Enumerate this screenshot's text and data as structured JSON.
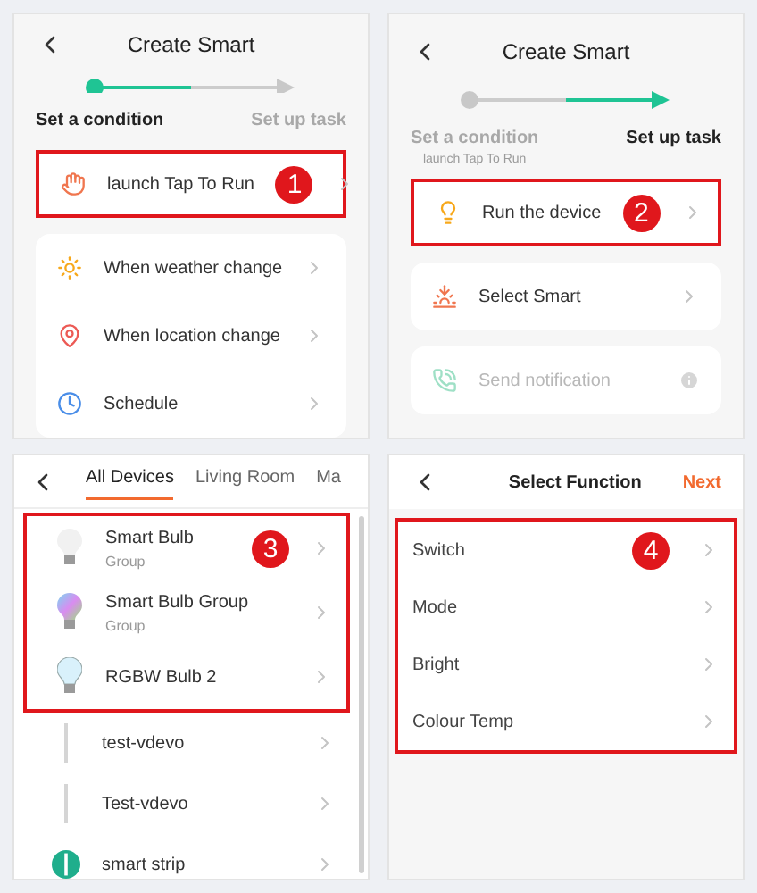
{
  "screens": [
    {
      "kind": "wizard",
      "title": "Create Smart",
      "steps": [
        {
          "label": "Set a condition",
          "selected": true
        },
        {
          "label": "Set up task",
          "selected": false
        }
      ],
      "highlighted": {
        "label": "launch Tap To Run",
        "kind": "tap",
        "callout": "1"
      },
      "cards": [
        {
          "items": [
            {
              "label": "When weather change",
              "kind": "weather",
              "disabled": false
            },
            {
              "label": "When location change",
              "kind": "location",
              "disabled": false
            },
            {
              "label": "Schedule",
              "kind": "schedule",
              "disabled": false
            }
          ]
        }
      ]
    },
    {
      "kind": "wizard",
      "title": "Create Smart",
      "steps": [
        {
          "label": "Set a condition",
          "sublabel": "launch Tap To Run",
          "selected": false
        },
        {
          "label": "Set up task",
          "selected": true
        }
      ],
      "highlighted": {
        "label": "Run the device",
        "kind": "device",
        "callout": "2"
      },
      "cards": [
        {
          "items": [
            {
              "label": "Select Smart",
              "kind": "scene",
              "disabled": false
            }
          ]
        },
        {
          "items": [
            {
              "label": "Send notification",
              "kind": "notify",
              "disabled": true
            }
          ]
        }
      ]
    },
    {
      "kind": "devices",
      "tabs": [
        {
          "label": "All Devices",
          "selected": true
        },
        {
          "label": "Living Room",
          "selected": false
        },
        {
          "label": "Ma",
          "selected": false
        }
      ],
      "callout": "3",
      "highlighted_devices": [
        {
          "name": "Smart Bulb",
          "subtitle": "Group",
          "kind": "bulb-white"
        },
        {
          "name": "Smart Bulb Group",
          "subtitle": "Group",
          "kind": "bulb-rgb"
        },
        {
          "name": "RGBW Bulb 2",
          "kind": "bulb-blue"
        }
      ],
      "devices": [
        {
          "name": "test-vdevo",
          "kind": "strip"
        },
        {
          "name": "Test-vdevo",
          "kind": "strip"
        },
        {
          "name": "smart strip",
          "kind": "strip-round"
        }
      ]
    },
    {
      "kind": "functions",
      "title": "Select Function",
      "action": "Next",
      "callout": "4",
      "functions": [
        "Switch",
        "Mode",
        "Bright",
        "Colour Temp"
      ]
    }
  ]
}
